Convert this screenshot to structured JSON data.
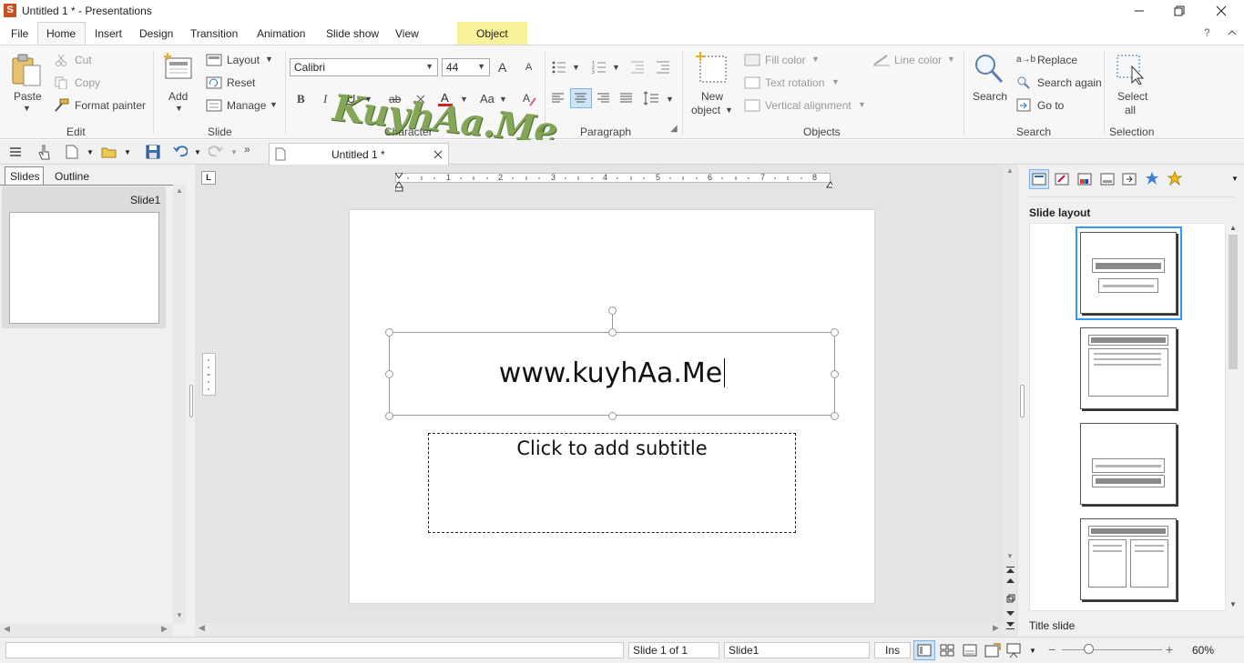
{
  "window": {
    "title": "Untitled 1 * - Presentations",
    "app_icon": "S"
  },
  "menu": {
    "items": [
      "File",
      "Home",
      "Insert",
      "Design",
      "Transition",
      "Animation",
      "Slide show",
      "View"
    ],
    "contextual_tab": "Object",
    "help": "?"
  },
  "ribbon": {
    "edit": {
      "paste": "Paste",
      "cut": "Cut",
      "copy": "Copy",
      "format_painter": "Format painter",
      "group": "Edit"
    },
    "slide": {
      "add": "Add",
      "layout": "Layout",
      "reset": "Reset",
      "manage": "Manage",
      "group": "Slide"
    },
    "character": {
      "font": "Calibri",
      "size": "44",
      "group": "Character",
      "bold": "B",
      "italic": "I",
      "underline": "U",
      "strike": "ab",
      "grow": "A",
      "shrink": "A"
    },
    "paragraph": {
      "group": "Paragraph"
    },
    "objects": {
      "new_object": "New",
      "new_object2": "object",
      "fill_color": "Fill color",
      "text_rotation": "Text rotation",
      "vertical_alignment": "Vertical alignment",
      "line_color": "Line color",
      "group": "Objects"
    },
    "search": {
      "search": "Search",
      "replace": "Replace",
      "search_again": "Search again",
      "go_to": "Go to",
      "group": "Search"
    },
    "selection": {
      "select_all": "Select",
      "select_all2": "all",
      "group": "Selection"
    }
  },
  "document_tab": {
    "title": "Untitled 1 *"
  },
  "left_pane": {
    "tabs": [
      "Slides",
      "Outline"
    ],
    "slide_label": "Slide1"
  },
  "slide": {
    "title_text": "www.kuyhAa.Me",
    "subtitle_placeholder": "Click to add subtitle"
  },
  "watermark": {
    "text": "KuyhAa.Me"
  },
  "ruler": {
    "numbers": [
      "1",
      "2",
      "3",
      "4",
      "5",
      "6",
      "7",
      "8"
    ]
  },
  "right_pane": {
    "heading": "Slide layout",
    "selected_layout_name": "Title slide"
  },
  "status": {
    "message": "",
    "slide_count": "Slide 1 of 1",
    "slide_name": "Slide1",
    "mode": "Ins",
    "zoom": "60%"
  },
  "colors": {
    "accent": "#3399ff",
    "object_tab": "#f7f29a",
    "app_icon": "#c8501e",
    "font_color_bar": "#d42020"
  }
}
